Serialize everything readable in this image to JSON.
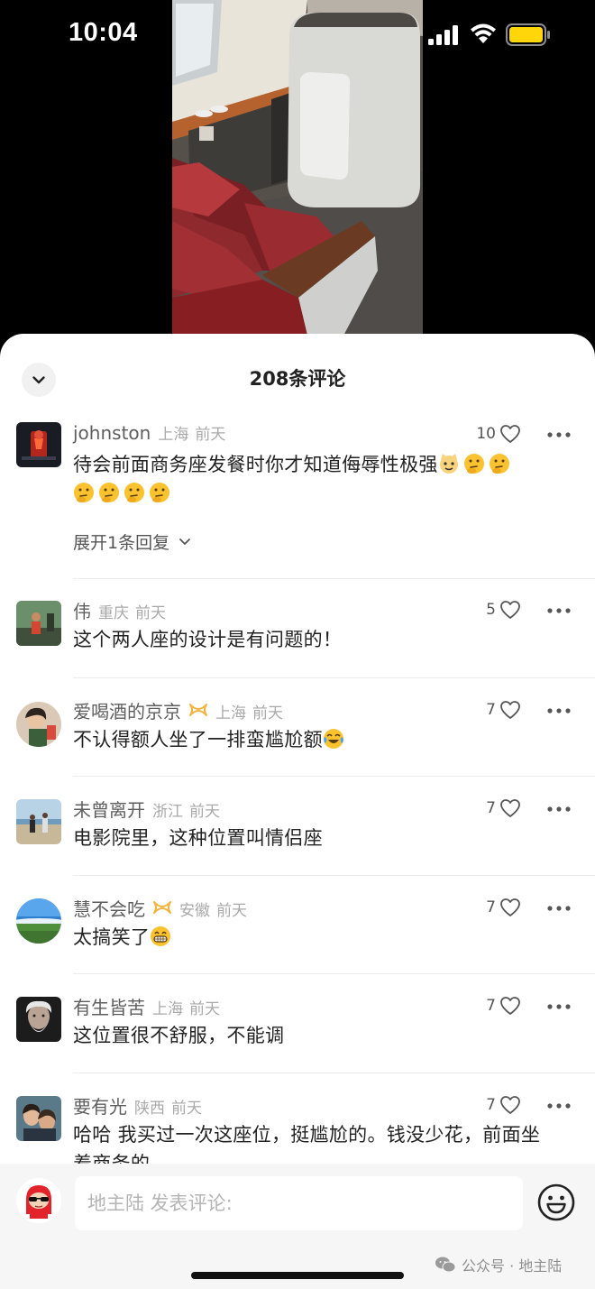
{
  "status": {
    "time": "10:04",
    "battery_color": "#ffd60a"
  },
  "sheet": {
    "title": "208条评论"
  },
  "comments": [
    {
      "author": "johnston",
      "location": "上海",
      "when": "前天",
      "likes": "10",
      "text": "待会前面商务座发餐时你才知道侮辱性极强",
      "emojis": [
        "cat-face-emoji",
        "thinking-face-emoji",
        "thinking-face-emoji",
        "thinking-face-emoji",
        "thinking-face-emoji",
        "thinking-face-emoji",
        "thinking-face-emoji"
      ],
      "expand_label": "展开1条回复"
    },
    {
      "author": "伟",
      "location": "重庆",
      "when": "前天",
      "likes": "5",
      "text": "这个两人座的设计是有问题的！"
    },
    {
      "author": "爱喝酒的京京",
      "location": "上海",
      "when": "前天",
      "likes": "7",
      "text": "不认得额人坐了一排蛮尴尬额",
      "emojis": [
        "crying-laughing-emoji"
      ],
      "badge": true
    },
    {
      "author": "未曾离开",
      "location": "浙江",
      "when": "前天",
      "likes": "7",
      "text": "电影院里，这种位置叫情侣座"
    },
    {
      "author": "慧不会吃",
      "location": "安徽",
      "when": "前天",
      "likes": "7",
      "text": "太搞笑了",
      "emojis": [
        "grinning-face-emoji"
      ],
      "badge": true
    },
    {
      "author": "有生皆苦",
      "location": "上海",
      "when": "前天",
      "likes": "7",
      "text": "这位置很不舒服，不能调"
    },
    {
      "author": "要有光",
      "location": "陕西",
      "when": "前天",
      "likes": "7",
      "text": "哈哈 我买过一次这座位，挺尴尬的。钱没少花，前面坐着商务的"
    }
  ],
  "input": {
    "placeholder": "地主陆 发表评论:"
  },
  "watermark": {
    "text": "公众号 · 地主陆"
  },
  "colors": {
    "accent_badge": "#f0b43c",
    "heart_stroke": "#555555",
    "sheet_bg": "#ffffff"
  }
}
